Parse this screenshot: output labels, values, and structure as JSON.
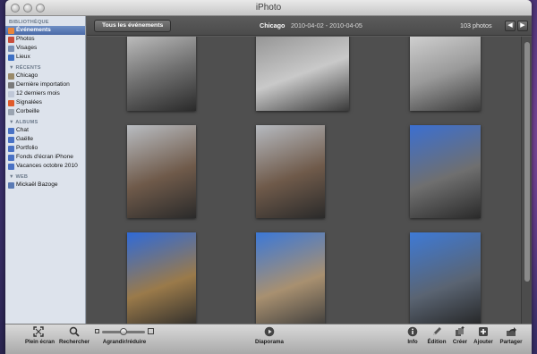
{
  "window": {
    "title": "iPhoto"
  },
  "sidebar": {
    "sections": [
      {
        "header": "BIBLIOTHÈQUE",
        "items": [
          {
            "label": "Événements",
            "icon": "events-icon",
            "color": "#e8853b",
            "selected": true
          },
          {
            "label": "Photos",
            "icon": "photos-icon",
            "color": "#c84d3c"
          },
          {
            "label": "Visages",
            "icon": "faces-icon",
            "color": "#7a8fb4"
          },
          {
            "label": "Lieux",
            "icon": "places-icon",
            "color": "#3d6fc4"
          }
        ]
      },
      {
        "header": "▼ RÉCENTS",
        "items": [
          {
            "label": "Chicago",
            "icon": "event-icon",
            "color": "#9a8a6a"
          },
          {
            "label": "Dernière importation",
            "icon": "import-icon",
            "color": "#7a7a7a"
          },
          {
            "label": "12 derniers mois",
            "icon": "calendar-icon",
            "color": "#c0c8d8"
          },
          {
            "label": "Signalées",
            "icon": "flag-icon",
            "color": "#e05a2a"
          },
          {
            "label": "Corbeille",
            "icon": "trash-icon",
            "color": "#9aa3b0"
          }
        ]
      },
      {
        "header": "▼ ALBUMS",
        "items": [
          {
            "label": "Chat",
            "icon": "album-icon",
            "color": "#4a72c4"
          },
          {
            "label": "Gaëlle",
            "icon": "album-icon",
            "color": "#4a72c4"
          },
          {
            "label": "Portfolio",
            "icon": "album-icon",
            "color": "#4a72c4"
          },
          {
            "label": "Fonds d'écran iPhone",
            "icon": "album-icon",
            "color": "#4a72c4"
          },
          {
            "label": "Vacances octobre 2010",
            "icon": "album-icon",
            "color": "#4a72c4"
          }
        ]
      },
      {
        "header": "▼ WEB",
        "items": [
          {
            "label": "Mickaël Bazoge",
            "icon": "web-album-icon",
            "color": "#5a7ab4"
          }
        ]
      }
    ]
  },
  "toolbar": {
    "back_label": "Tous les événements",
    "event_title": "Chicago",
    "event_dates": "2010-04-02 - 2010-04-05",
    "photo_count": "103 photos",
    "prev_glyph": "◀",
    "next_glyph": "▶"
  },
  "photos": [
    {
      "name": "photo-building-facade",
      "colors": [
        "#cfcfcf",
        "#6f6f6f",
        "#2a2a2a"
      ]
    },
    {
      "name": "photo-stone-ornament",
      "colors": [
        "#8a8a8a",
        "#c9c9c9",
        "#3a3a3a"
      ]
    },
    {
      "name": "photo-apple-store-front",
      "colors": [
        "#dcdcdc",
        "#9a9a9a",
        "#3a3a3a"
      ]
    },
    {
      "name": "photo-man-with-ipad-1",
      "colors": [
        "#b9bdc2",
        "#6f5a4a",
        "#2a2a2a"
      ]
    },
    {
      "name": "photo-man-with-ipad-2",
      "colors": [
        "#b6bac0",
        "#6f5a4a",
        "#2a2a2a"
      ]
    },
    {
      "name": "photo-skyscrapers-blue-sky",
      "colors": [
        "#3b6fd1",
        "#6f6f6f",
        "#2a2a2a"
      ]
    },
    {
      "name": "photo-water-tower-tree",
      "colors": [
        "#2f6ad8",
        "#9a7a4a",
        "#2a2a2a"
      ]
    },
    {
      "name": "photo-water-tower",
      "colors": [
        "#3b78d8",
        "#a89070",
        "#3a3a3a"
      ]
    },
    {
      "name": "photo-hancock-tower",
      "colors": [
        "#3e7ad6",
        "#5a6472",
        "#222"
      ]
    }
  ],
  "bottombar": {
    "tools": [
      {
        "name": "fullscreen-button",
        "label": "Plein écran",
        "icon": "fullscreen-icon"
      },
      {
        "name": "search-button",
        "label": "Rechercher",
        "icon": "search-icon"
      },
      {
        "name": "zoom-control",
        "label": "Agrandir/réduire",
        "icon": "zoom-slider-icon"
      },
      {
        "name": "slideshow-button",
        "label": "Diaporama",
        "icon": "play-icon"
      },
      {
        "name": "info-button",
        "label": "Info",
        "icon": "info-icon"
      },
      {
        "name": "edit-button",
        "label": "Édition",
        "icon": "pencil-icon"
      },
      {
        "name": "create-button",
        "label": "Créer",
        "icon": "create-icon"
      },
      {
        "name": "add-button",
        "label": "Ajouter",
        "icon": "plus-icon"
      },
      {
        "name": "share-button",
        "label": "Partager",
        "icon": "share-icon"
      }
    ]
  }
}
